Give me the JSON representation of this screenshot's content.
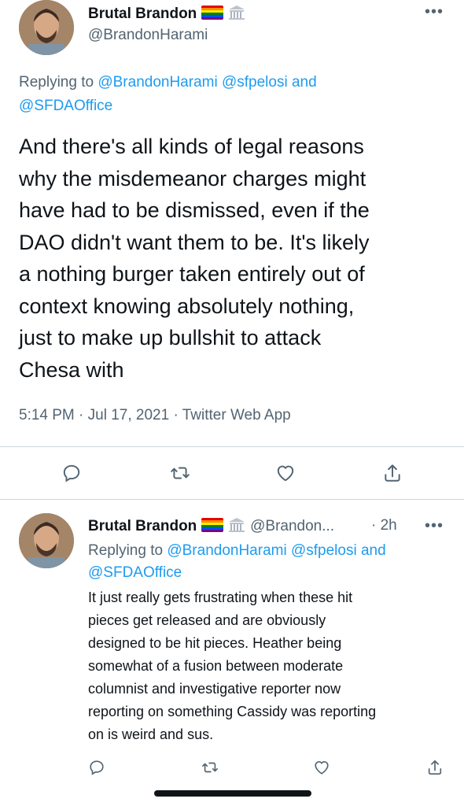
{
  "tweet": {
    "author_name": "Brutal Brandon",
    "author_handle": "@BrandonHarami",
    "more": "•••",
    "replying_prefix": "Replying to ",
    "replying_mentions_line1": "@BrandonHarami @sfpelosi and",
    "replying_mentions_line2": "@SFDAOffice",
    "text_lines": [
      "And there's all kinds of legal reasons",
      "why the misdemeanor charges might",
      "have had to be dismissed, even if the",
      "DAO didn't want them to be. It's likely",
      "a nothing burger taken entirely out of",
      "context knowing absolutely nothing,",
      "just to make up bullshit to attack",
      "Chesa with"
    ],
    "meta": "5:14 PM · Jul 17, 2021 · Twitter Web App"
  },
  "reply": {
    "author_name": "Brutal Brandon",
    "author_handle": "@Brandon...",
    "time": "· 2h",
    "more": "•••",
    "replying_prefix": "Replying to ",
    "replying_mentions_line1": "@BrandonHarami @sfpelosi and",
    "replying_mentions_line2": "@SFDAOffice",
    "text_lines": [
      "It just really gets frustrating when these hit",
      "pieces get released and are obviously",
      "designed to be hit pieces. Heather being",
      "somewhat of a fusion between moderate",
      "columnist and investigative reporter now",
      "reporting on something Cassidy was reporting",
      "on is weird and sus."
    ]
  },
  "icons": {
    "reply": "reply-icon",
    "retweet": "retweet-icon",
    "like": "heart-icon",
    "share": "share-icon",
    "flag": "rainbow-flag-icon",
    "building": "government-building-icon"
  },
  "colors": {
    "link": "#1d9bf0",
    "secondary_text": "#536471",
    "primary_text": "#0f1419"
  }
}
